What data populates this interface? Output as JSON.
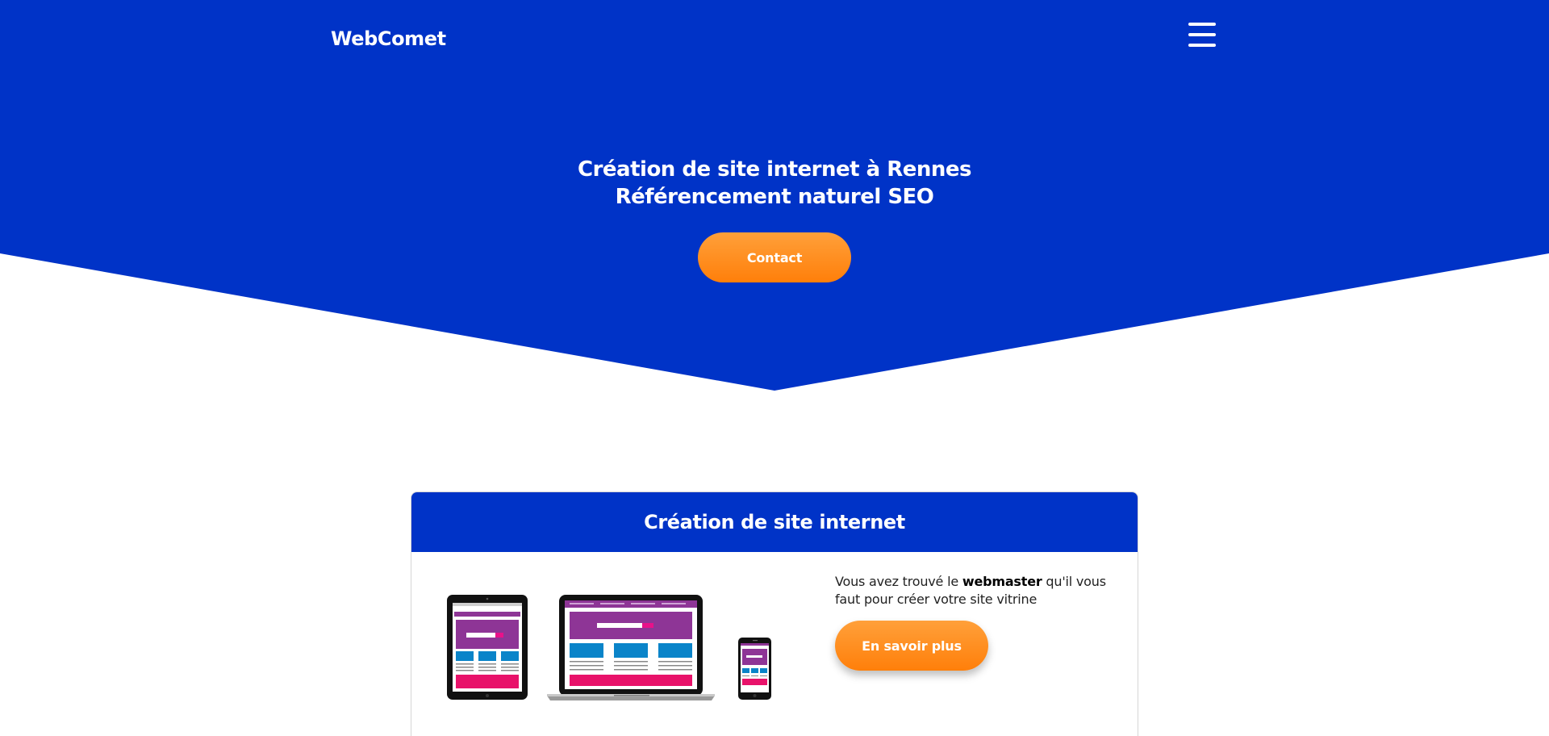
{
  "header": {
    "brand": "WebComet",
    "menu_icon": "hamburger-menu-icon"
  },
  "hero": {
    "title_line1": "Création de site internet à Rennes",
    "title_line2": "Référencement naturel SEO",
    "cta_label": "Contact"
  },
  "card": {
    "title": "Création de site internet",
    "illustration": "responsive-devices-illustration",
    "text_before": "Vous avez trouvé le ",
    "text_bold": "webmaster",
    "text_after": " qu'il vous faut pour créer votre site vitrine",
    "button_label": "En savoir plus"
  },
  "colors": {
    "primary": "#0033c7",
    "accent": "#ff8c1a",
    "white": "#ffffff"
  }
}
